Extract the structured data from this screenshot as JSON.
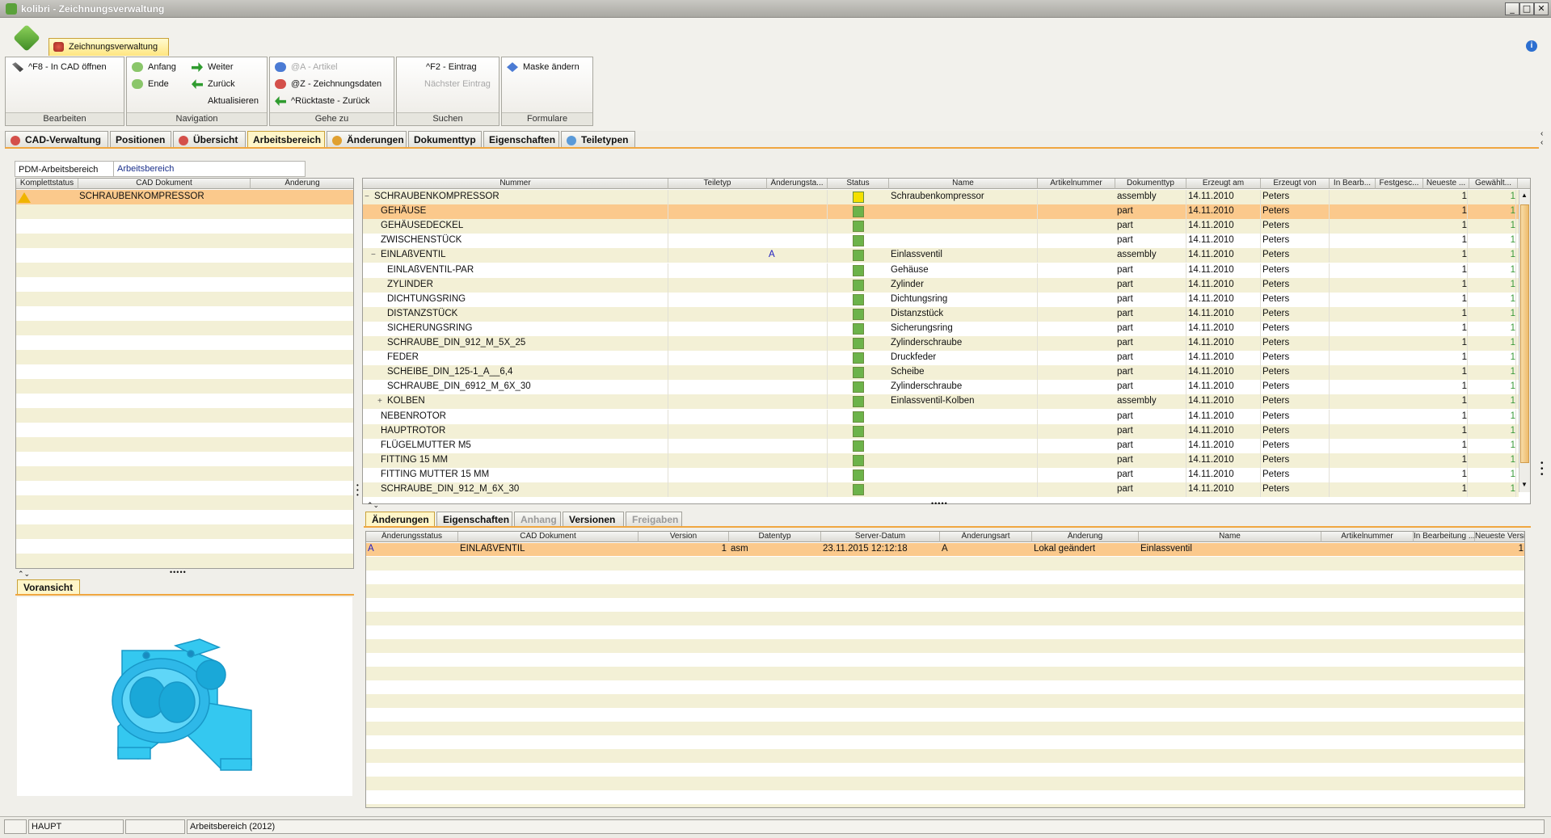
{
  "window": {
    "title": "kolibri - Zeichnungsverwaltung"
  },
  "ribbon": {
    "app_tab": "Zeichnungsverwaltung",
    "groups": {
      "bearbeiten": {
        "label": "Bearbeiten",
        "items": [
          "^F8 - In CAD öffnen"
        ]
      },
      "navigation": {
        "label": "Navigation",
        "items": [
          "Anfang",
          "Ende",
          "Weiter",
          "Zurück",
          "Aktualisieren"
        ]
      },
      "gehezu": {
        "label": "Gehe zu",
        "items": [
          "@A - Artikel",
          "@Z - Zeichnungsdaten",
          "^Rücktaste - Zurück"
        ]
      },
      "suchen": {
        "label": "Suchen",
        "items": [
          "^F2 - Eintrag",
          "Nächster Eintrag"
        ]
      },
      "formulare": {
        "label": "Formulare",
        "items": [
          "Maske ändern"
        ]
      }
    }
  },
  "main_tabs": [
    "CAD-Verwaltung",
    "Positionen",
    "Übersicht",
    "Arbeitsbereich",
    "Änderungen",
    "Dokumenttyp",
    "Eigenschaften",
    "Teiletypen"
  ],
  "workspace": {
    "label": "PDM-Arbeitsbereich",
    "value": "Arbeitsbereich"
  },
  "left_grid": {
    "headers": [
      "Komplettstatus",
      "CAD Dokument",
      "Änderung"
    ],
    "rows": [
      {
        "doc": "SCHRAUBENKOMPRESSOR"
      }
    ]
  },
  "preview": {
    "tab": "Voransicht"
  },
  "main_grid": {
    "headers": [
      "Nummer",
      "Teiletyp",
      "Änderungsta...",
      "Status",
      "Name",
      "Artikelnummer",
      "Dokumenttyp",
      "Erzeugt am",
      "Erzeugt von",
      "In Bearb...",
      "Festgesc...",
      "Neueste ...",
      "Gewählt..."
    ],
    "rows": [
      {
        "nummer": "SCHRAUBENKOMPRESSOR",
        "exp": "−",
        "aend": "",
        "status": "#f4e000",
        "name": "Schraubenkompressor",
        "dtyp": "assembly",
        "date": "14.11.2010",
        "von": "Peters",
        "n": "1",
        "g": "1",
        "lvl": 0
      },
      {
        "nummer": "GEHÄUSE",
        "exp": "",
        "aend": "",
        "status": "#6cb34a",
        "name": "",
        "dtyp": "part",
        "date": "14.11.2010",
        "von": "Peters",
        "n": "1",
        "g": "1",
        "lvl": 1
      },
      {
        "nummer": "GEHÄUSEDECKEL",
        "exp": "",
        "aend": "",
        "status": "#6cb34a",
        "name": "",
        "dtyp": "part",
        "date": "14.11.2010",
        "von": "Peters",
        "n": "1",
        "g": "1",
        "lvl": 1
      },
      {
        "nummer": "ZWISCHENSTÜCK",
        "exp": "",
        "aend": "",
        "status": "#6cb34a",
        "name": "",
        "dtyp": "part",
        "date": "14.11.2010",
        "von": "Peters",
        "n": "1",
        "g": "1",
        "lvl": 1
      },
      {
        "nummer": "EINLAßVENTIL",
        "exp": "−",
        "aend": "A",
        "status": "#6cb34a",
        "name": "Einlassventil",
        "dtyp": "assembly",
        "date": "14.11.2010",
        "von": "Peters",
        "n": "1",
        "g": "1",
        "lvl": 1
      },
      {
        "nummer": "EINLAßVENTIL-PAR",
        "exp": "",
        "aend": "",
        "status": "#6cb34a",
        "name": "Gehäuse",
        "dtyp": "part",
        "date": "14.11.2010",
        "von": "Peters",
        "n": "1",
        "g": "1",
        "lvl": 2
      },
      {
        "nummer": "ZYLINDER",
        "exp": "",
        "aend": "",
        "status": "#6cb34a",
        "name": "Zylinder",
        "dtyp": "part",
        "date": "14.11.2010",
        "von": "Peters",
        "n": "1",
        "g": "1",
        "lvl": 2
      },
      {
        "nummer": "DICHTUNGSRING",
        "exp": "",
        "aend": "",
        "status": "#6cb34a",
        "name": "Dichtungsring",
        "dtyp": "part",
        "date": "14.11.2010",
        "von": "Peters",
        "n": "1",
        "g": "1",
        "lvl": 2
      },
      {
        "nummer": "DISTANZSTÜCK",
        "exp": "",
        "aend": "",
        "status": "#6cb34a",
        "name": "Distanzstück",
        "dtyp": "part",
        "date": "14.11.2010",
        "von": "Peters",
        "n": "1",
        "g": "1",
        "lvl": 2
      },
      {
        "nummer": "SICHERUNGSRING",
        "exp": "",
        "aend": "",
        "status": "#6cb34a",
        "name": "Sicherungsring",
        "dtyp": "part",
        "date": "14.11.2010",
        "von": "Peters",
        "n": "1",
        "g": "1",
        "lvl": 2
      },
      {
        "nummer": "SCHRAUBE_DIN_912_M_5X_25",
        "exp": "",
        "aend": "",
        "status": "#6cb34a",
        "name": "Zylinderschraube",
        "dtyp": "part",
        "date": "14.11.2010",
        "von": "Peters",
        "n": "1",
        "g": "1",
        "lvl": 2
      },
      {
        "nummer": "FEDER",
        "exp": "",
        "aend": "",
        "status": "#6cb34a",
        "name": "Druckfeder",
        "dtyp": "part",
        "date": "14.11.2010",
        "von": "Peters",
        "n": "1",
        "g": "1",
        "lvl": 2
      },
      {
        "nummer": "SCHEIBE_DIN_125-1_A__6,4",
        "exp": "",
        "aend": "",
        "status": "#6cb34a",
        "name": "Scheibe",
        "dtyp": "part",
        "date": "14.11.2010",
        "von": "Peters",
        "n": "1",
        "g": "1",
        "lvl": 2
      },
      {
        "nummer": "SCHRAUBE_DIN_6912_M_6X_30",
        "exp": "",
        "aend": "",
        "status": "#6cb34a",
        "name": "Zylinderschraube",
        "dtyp": "part",
        "date": "14.11.2010",
        "von": "Peters",
        "n": "1",
        "g": "1",
        "lvl": 2
      },
      {
        "nummer": "KOLBEN",
        "exp": "+",
        "aend": "",
        "status": "#6cb34a",
        "name": "Einlassventil-Kolben",
        "dtyp": "assembly",
        "date": "14.11.2010",
        "von": "Peters",
        "n": "1",
        "g": "1",
        "lvl": 2
      },
      {
        "nummer": "NEBENROTOR",
        "exp": "",
        "aend": "",
        "status": "#6cb34a",
        "name": "",
        "dtyp": "part",
        "date": "14.11.2010",
        "von": "Peters",
        "n": "1",
        "g": "1",
        "lvl": 1
      },
      {
        "nummer": "HAUPTROTOR",
        "exp": "",
        "aend": "",
        "status": "#6cb34a",
        "name": "",
        "dtyp": "part",
        "date": "14.11.2010",
        "von": "Peters",
        "n": "1",
        "g": "1",
        "lvl": 1
      },
      {
        "nummer": "FLÜGELMUTTER M5",
        "exp": "",
        "aend": "",
        "status": "#6cb34a",
        "name": "",
        "dtyp": "part",
        "date": "14.11.2010",
        "von": "Peters",
        "n": "1",
        "g": "1",
        "lvl": 1
      },
      {
        "nummer": "FITTING 15 MM",
        "exp": "",
        "aend": "",
        "status": "#6cb34a",
        "name": "",
        "dtyp": "part",
        "date": "14.11.2010",
        "von": "Peters",
        "n": "1",
        "g": "1",
        "lvl": 1
      },
      {
        "nummer": "FITTING  MUTTER 15 MM",
        "exp": "",
        "aend": "",
        "status": "#6cb34a",
        "name": "",
        "dtyp": "part",
        "date": "14.11.2010",
        "von": "Peters",
        "n": "1",
        "g": "1",
        "lvl": 1
      },
      {
        "nummer": "SCHRAUBE_DIN_912_M_6X_30",
        "exp": "",
        "aend": "",
        "status": "#6cb34a",
        "name": "",
        "dtyp": "part",
        "date": "14.11.2010",
        "von": "Peters",
        "n": "1",
        "g": "1",
        "lvl": 1
      }
    ]
  },
  "sub_tabs": [
    "Änderungen",
    "Eigenschaften",
    "Anhang",
    "Versionen",
    "Freigaben"
  ],
  "changes_grid": {
    "headers": [
      "Änderungsstatus",
      "CAD Dokument",
      "Version",
      "Datentyp",
      "Server-Datum",
      "Änderungsart",
      "Änderung",
      "Name",
      "Artikelnummer",
      "In Bearbeitung ...",
      "Neueste Version"
    ],
    "rows": [
      {
        "status": "A",
        "doc": "EINLAßVENTIL",
        "version": "1",
        "typ": "asm",
        "date": "23.11.2015 12:12:18",
        "art": "A",
        "aend": "Lokal geändert",
        "name": "Einlassventil",
        "neu": "1"
      }
    ]
  },
  "statusbar": {
    "mode": "HAUPT",
    "context": "Arbeitsbereich (2012)"
  },
  "colors": {
    "selected_row": "#fbc98c",
    "alt_row": "#f3f0d6",
    "accent": "#f0a640",
    "status_green": "#6cb34a",
    "status_yellow": "#f4e000",
    "model": "#34c8f0"
  }
}
